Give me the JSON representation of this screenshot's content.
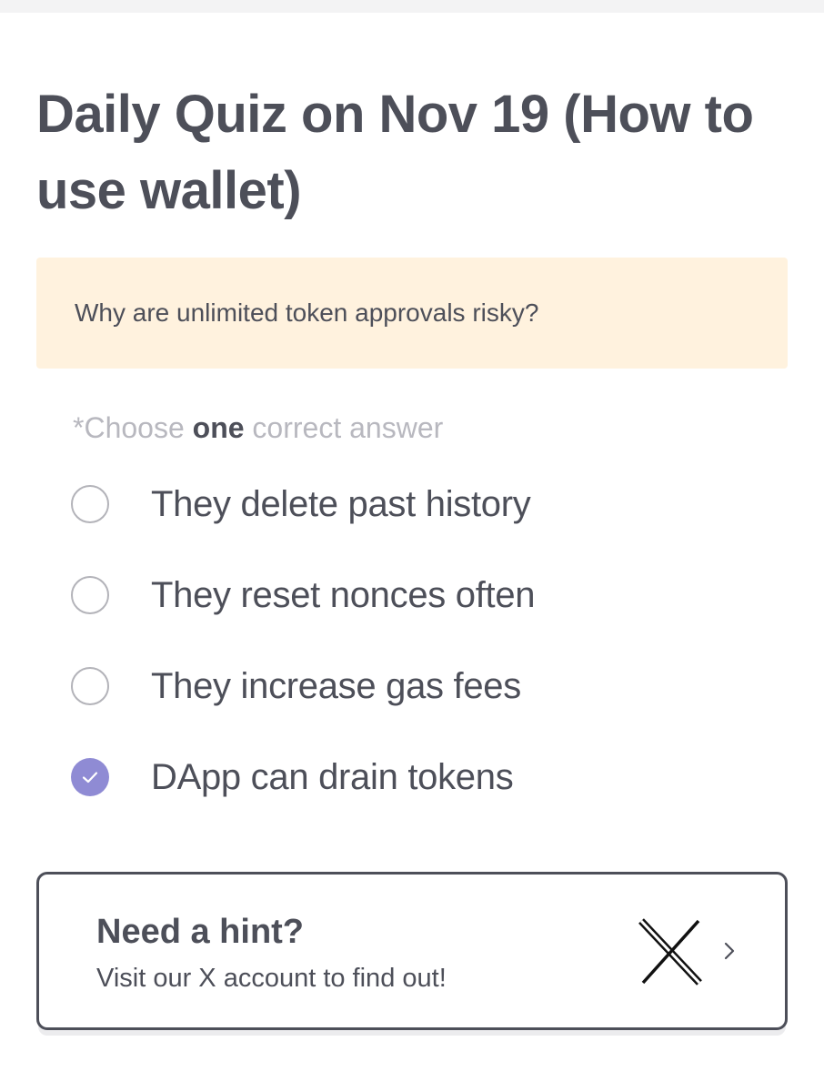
{
  "quiz": {
    "title": "Daily Quiz on Nov 19 (How to use wallet)",
    "question": "Why are unlimited token approvals risky?",
    "instruction": {
      "prefix": "*Choose ",
      "emphasis": "one",
      "suffix": " correct answer"
    },
    "options": [
      {
        "label": "They delete past history",
        "selected": false
      },
      {
        "label": "They reset nonces often",
        "selected": false
      },
      {
        "label": "They increase gas fees",
        "selected": false
      },
      {
        "label": "DApp can drain tokens",
        "selected": true
      }
    ]
  },
  "hint": {
    "title": "Need a hint?",
    "subtitle": "Visit our X account to find out!",
    "icon": "x-logo-icon",
    "chevron_icon": "chevron-right-icon"
  },
  "colors": {
    "text": "#4d4f59",
    "muted": "#b8b8bf",
    "question_bg": "#fff2de",
    "accent": "#8f8bd4"
  }
}
